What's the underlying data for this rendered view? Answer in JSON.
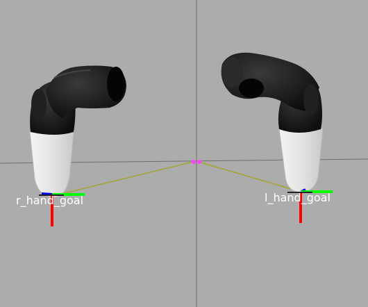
{
  "viewport": {
    "background": "#acacac",
    "labels": {
      "right_goal": "r_hand_goal",
      "left_goal": "l_hand_goal"
    },
    "colors": {
      "grid_line": "#6a6a6a",
      "arm_link": "#1a1a1a",
      "hand_shell": "#e6e6e6",
      "goal_link_line": "#a4a430",
      "axis_x": "#ff0000",
      "axis_y": "#00ff00",
      "axis_z": "#0000ff",
      "center_marker": "#ff40ff"
    },
    "icons": [
      "right-arm-model",
      "left-arm-model",
      "right-goal-axes-icon",
      "left-goal-axes-icon",
      "center-marker-icon"
    ]
  }
}
